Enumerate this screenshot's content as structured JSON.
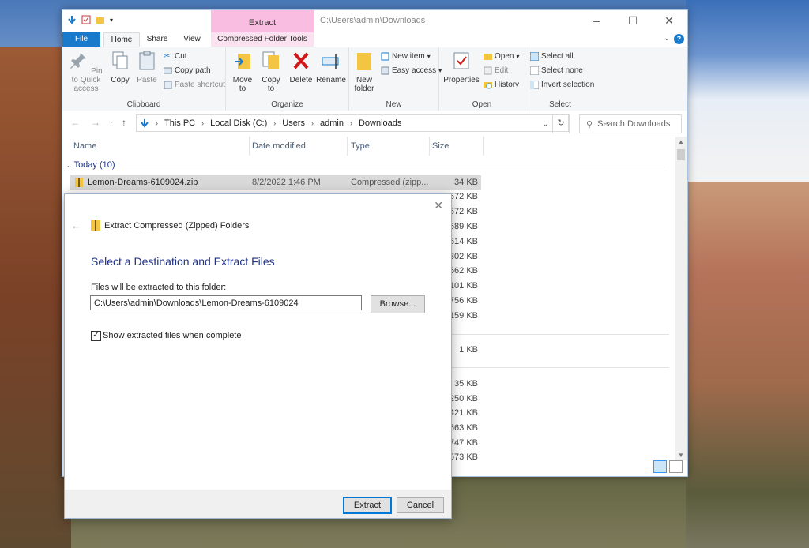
{
  "window": {
    "context_tab": "Extract",
    "title": "C:\\Users\\admin\\Downloads",
    "controls": [
      "–",
      "☐",
      "✕"
    ]
  },
  "tabs": {
    "file": "File",
    "home": "Home",
    "share": "Share",
    "view": "View",
    "compressed": "Compressed Folder Tools"
  },
  "ribbon": {
    "clipboard": {
      "label": "Clipboard",
      "pin": "Pin to Quick access",
      "copy": "Copy",
      "paste": "Paste",
      "cut": "Cut",
      "copy_path": "Copy path",
      "paste_shortcut": "Paste shortcut"
    },
    "organize": {
      "label": "Organize",
      "move_to": "Move to",
      "copy_to": "Copy to",
      "delete": "Delete",
      "rename": "Rename"
    },
    "new": {
      "label": "New",
      "new_folder": "New folder",
      "new_item": "New item",
      "easy_access": "Easy access"
    },
    "open": {
      "label": "Open",
      "properties": "Properties",
      "open": "Open",
      "edit": "Edit",
      "history": "History"
    },
    "select": {
      "label": "Select",
      "select_all": "Select all",
      "select_none": "Select none",
      "invert": "Invert selection"
    }
  },
  "address": {
    "crumbs": [
      "This PC",
      "Local Disk (C:)",
      "Users",
      "admin",
      "Downloads"
    ],
    "search_placeholder": "Search Downloads"
  },
  "columns": {
    "name": "Name",
    "date": "Date modified",
    "type": "Type",
    "size": "Size"
  },
  "group": "Today (10)",
  "selected_file": {
    "name": "Lemon-Dreams-6109024.zip",
    "date": "8/2/2022 1:46 PM",
    "type": "Compressed (zipp...",
    "size": "34 KB"
  },
  "sizes": [
    "672 KB",
    "672 KB",
    "589 KB",
    ",614 KB",
    "302 KB",
    "662 KB",
    ",101 KB",
    "756 KB",
    "159 KB",
    "1 KB",
    "35 KB",
    ",250 KB",
    ",421 KB",
    ",663 KB",
    ",747 KB",
    "573 KB"
  ],
  "dialog": {
    "title": "Extract Compressed (Zipped) Folders",
    "heading": "Select a Destination and Extract Files",
    "path_label": "Files will be extracted to this folder:",
    "path": "C:\\Users\\admin\\Downloads\\Lemon-Dreams-6109024",
    "browse": "Browse...",
    "checkbox_label": "Show extracted files when complete",
    "checked": true,
    "extract": "Extract",
    "cancel": "Cancel"
  }
}
